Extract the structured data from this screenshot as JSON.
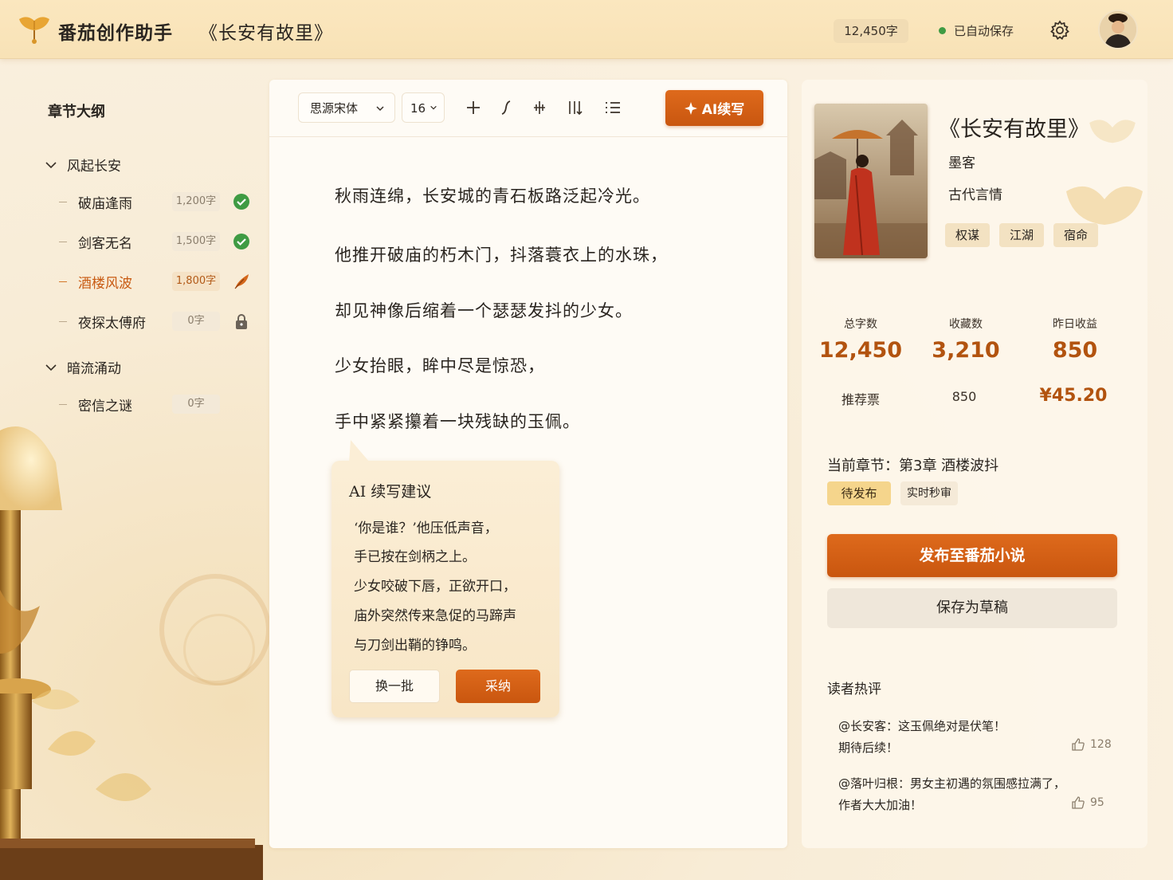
{
  "header": {
    "app_title": "番茄创作助手",
    "book_title": "《长安有故里》",
    "word_count": "12,450字",
    "save_status": "已自动保存"
  },
  "outline": {
    "title": "章节大纲",
    "volumes": [
      {
        "label": "风起长安",
        "chapters": [
          {
            "name": "破庙逢雨",
            "count": "1,200字",
            "status": "done"
          },
          {
            "name": "剑客无名",
            "count": "1,500字",
            "status": "done"
          },
          {
            "name": "酒楼风波",
            "count": "1,800字",
            "status": "writing"
          },
          {
            "name": "夜探太傅府",
            "count": "0字",
            "status": "locked"
          }
        ]
      },
      {
        "label": "暗流涌动",
        "chapters": [
          {
            "name": "密信之谜",
            "count": "0字",
            "status": "none"
          }
        ]
      }
    ]
  },
  "toolbar": {
    "font": "思源宋体",
    "size": "16",
    "ai_label": "AI续写"
  },
  "editor": {
    "paragraphs": [
      "秋雨连绵，长安城的青石板路泛起冷光。",
      "他推开破庙的朽木门，抖落蓑衣上的水珠，",
      "却见神像后缩着一个瑟瑟发抖的少女。",
      "少女抬眼，眸中尽是惊恐，",
      "手中紧紧攥着一块残缺的玉佩。"
    ]
  },
  "suggestion": {
    "title": "AI 续写建议",
    "lines": [
      "‘你是谁？’他压低声音，",
      "手已按在剑柄之上。",
      "少女咬破下唇，正欲开口，",
      "庙外突然传来急促的马蹄声",
      "与刀剑出鞘的铮鸣。"
    ],
    "swap_label": "换一批",
    "accept_label": "采纳"
  },
  "book": {
    "title": "《长安有故里》",
    "author": "墨客",
    "genre": "古代言情",
    "tags": [
      "权谋",
      "江湖",
      "宿命"
    ]
  },
  "stats": {
    "total_label": "总字数",
    "total_value": "12,450",
    "fav_label": "收藏数",
    "fav_value": "3,210",
    "income_label": "昨日收益",
    "income_value": "850",
    "rec_label": "推荐票",
    "rec_value": "850",
    "money_value": "¥45.20"
  },
  "publish": {
    "current_chapter": "当前章节：第3章 酒楼波抖",
    "status_badge": "待发布",
    "audit_badge": "实时秒审",
    "publish_label": "发布至番茄小说",
    "draft_label": "保存为草稿"
  },
  "comments": {
    "title": "读者热评",
    "items": [
      {
        "line1": "@长安客：这玉佩绝对是伏笔！",
        "line2": "期待后续！",
        "likes": "128"
      },
      {
        "line1": "@落叶归根：男女主初遇的氛围感拉满了，",
        "line2": "作者大大加油！",
        "likes": "95"
      }
    ]
  },
  "colors": {
    "accent": "#c9560f",
    "header_bg": "#f8e2b6",
    "done_green": "#3f9b43"
  },
  "icons": {
    "logo": "ginkgo-leaf-icon",
    "settings": "gear-icon",
    "done": "check-circle-icon",
    "writing": "feather-pen-icon",
    "locked": "lock-icon",
    "like": "thumbs-up-icon"
  }
}
